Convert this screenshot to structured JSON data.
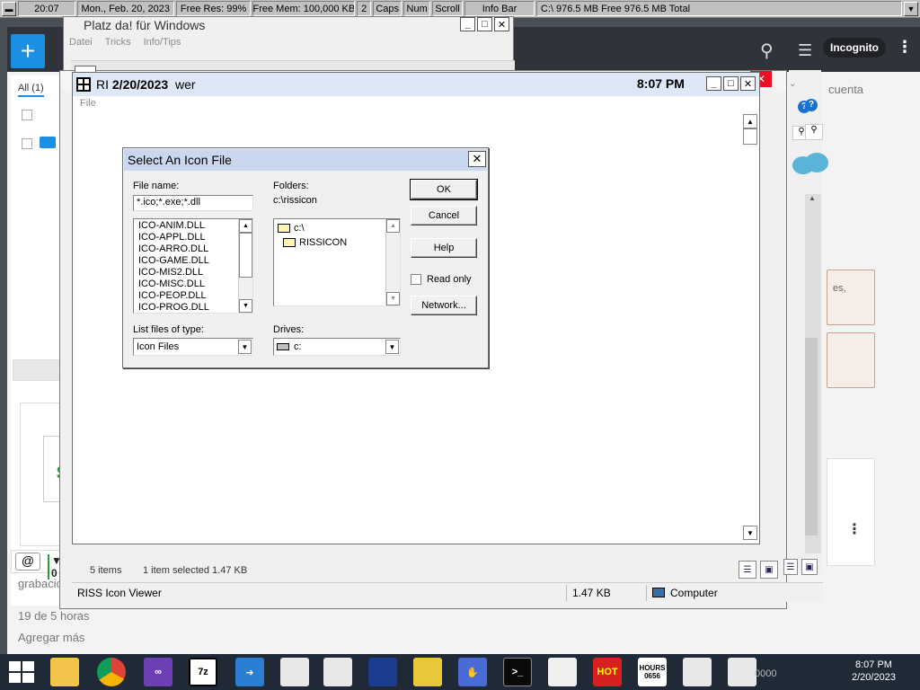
{
  "infobar": {
    "time": "20:07",
    "date": "Mon., Feb. 20, 2023",
    "free_res": "Free Res: 99%",
    "free_mem": "Free Mem: 100,000 KB",
    "count": "2",
    "caps": "Caps",
    "num": "Num",
    "scroll": "Scroll",
    "title": "Info Bar",
    "disk": "C:\\ 976.5 MB Free  976.5 MB Total"
  },
  "browser": {
    "all_tab": "All (1)",
    "incognito": "Incognito",
    "cuenta": "cuenta",
    "bottom_text_1": "grabacion",
    "bottom_text_2": "19 de 5 horas",
    "bottom_text_3": "Agregar más",
    "card_text": "es,"
  },
  "platz": {
    "title": "Platz da! für Windows",
    "menu": [
      "Datei",
      "Tricks",
      "Info/Tips"
    ]
  },
  "ri": {
    "title_prefix": "RI",
    "title_date": "2/20/2023",
    "title_suffix": "wer",
    "time": "8:07 PM",
    "menu_file": "File"
  },
  "window2": {
    "items": "5 items",
    "selected": "1 item selected  1.47 KB",
    "app_name": "RISS Icon Viewer",
    "size": "1.47 KB",
    "location": "Computer"
  },
  "dialog": {
    "title": "Select An Icon File",
    "file_name_label": "File name:",
    "file_name_value": "*.ico;*.exe;*.dll",
    "files": [
      "ICO-ANIM.DLL",
      "ICO-APPL.DLL",
      "ICO-ARRO.DLL",
      "ICO-GAME.DLL",
      "ICO-MIS2.DLL",
      "ICO-MISC.DLL",
      "ICO-PEOP.DLL",
      "ICO-PROG.DLL"
    ],
    "folders_label": "Folders:",
    "folders_path": "c:\\rissicon",
    "folders": [
      "c:\\",
      "RISSICON"
    ],
    "list_type_label": "List files of type:",
    "list_type_value": "Icon Files",
    "drives_label": "Drives:",
    "drives_value": "c:",
    "ok": "OK",
    "cancel": "Cancel",
    "help": "Help",
    "read_only": "Read only",
    "network": "Network..."
  },
  "taskbar": {
    "time": "8:07 PM",
    "date": "2/20/2023",
    "tray_text": "0000",
    "apps": [
      "7z",
      "HOT",
      "HOURS",
      "0656"
    ]
  }
}
